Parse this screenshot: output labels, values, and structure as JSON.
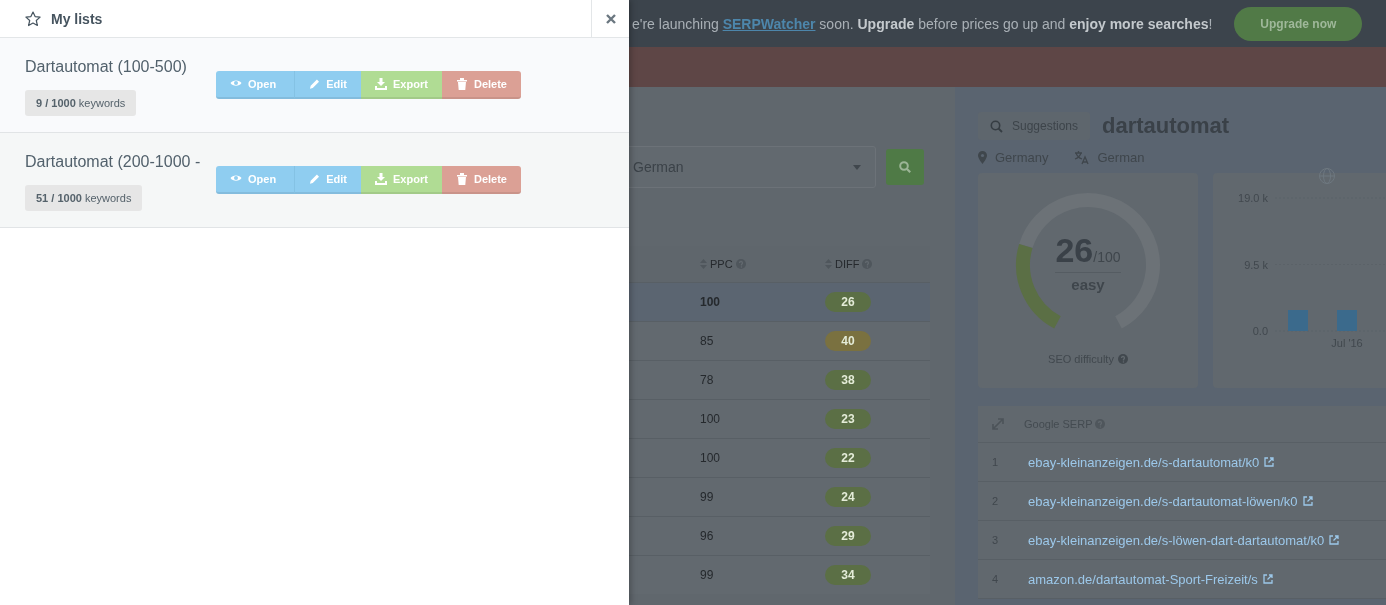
{
  "banner": {
    "segments": [
      {
        "kind": "text",
        "text": "e're launching "
      },
      {
        "kind": "link",
        "text": "SERPWatcher"
      },
      {
        "kind": "text",
        "text": " soon. **Upgrade** before prices go up and **enjoy more searches**!"
      }
    ],
    "button": "Upgrade now"
  },
  "keyword_table": {
    "language": "German",
    "columns": [
      "PPC",
      "DIFF"
    ],
    "rows": [
      {
        "ppc": "100",
        "diff": "26",
        "color": "#5b6f45",
        "selected": true
      },
      {
        "ppc": "85",
        "diff": "40",
        "color": "#7a7140",
        "selected": false
      },
      {
        "ppc": "78",
        "diff": "38",
        "color": "#5b6f45",
        "selected": false
      },
      {
        "ppc": "100",
        "diff": "23",
        "color": "#5b6f45",
        "selected": false
      },
      {
        "ppc": "100",
        "diff": "22",
        "color": "#5b6f45",
        "selected": false
      },
      {
        "ppc": "99",
        "diff": "24",
        "color": "#5b6f45",
        "selected": false
      },
      {
        "ppc": "96",
        "diff": "29",
        "color": "#5b6f45",
        "selected": false
      },
      {
        "ppc": "99",
        "diff": "34",
        "color": "#5b6f45",
        "selected": false
      }
    ]
  },
  "keyword_panel": {
    "suggestions": "Suggestions",
    "keyword": "dartautomat",
    "location": "Germany",
    "language": "German",
    "difficulty": {
      "score": "26",
      "max": "/100",
      "label": "easy",
      "caption": "SEO difficulty",
      "level": 0.26
    },
    "chart_data": {
      "type": "bar",
      "categories": [
        null,
        "Jul '16"
      ],
      "values": [
        3000,
        3000
      ],
      "yticks": [
        {
          "value": 0,
          "label": "0.0"
        },
        {
          "value": 9500,
          "label": "9.5 k"
        },
        {
          "value": 19000,
          "label": "19.0 k"
        }
      ],
      "ylim": [
        0,
        19000
      ]
    },
    "serp": {
      "heading": "Google SERP",
      "rows": [
        {
          "rank": "1",
          "url": "ebay-kleinanzeigen.de/s-dartautomat/k0"
        },
        {
          "rank": "2",
          "url": "ebay-kleinanzeigen.de/s-dartautomat-löwen/k0"
        },
        {
          "rank": "3",
          "url": "ebay-kleinanzeigen.de/s-löwen-dart-dartautomat/k0"
        },
        {
          "rank": "4",
          "url": "amazon.de/dartautomat-Sport-Freizeit/s"
        }
      ]
    }
  },
  "drawer": {
    "title": "My lists",
    "lists": [
      {
        "title": "Dartautomat (100-500)",
        "keywords": "**9 / 1000** keywords",
        "actions": [
          {
            "kind": "open",
            "label": "Open"
          },
          {
            "kind": "edit",
            "label": "Edit"
          },
          {
            "kind": "export",
            "label": "Export"
          },
          {
            "kind": "delete",
            "label": "Delete"
          }
        ]
      },
      {
        "title": "Dartautomat (200-1000 -",
        "keywords": "**51 / 1000** keywords",
        "actions": [
          {
            "kind": "open",
            "label": "Open"
          },
          {
            "kind": "edit",
            "label": "Edit"
          },
          {
            "kind": "export",
            "label": "Export"
          },
          {
            "kind": "delete",
            "label": "Delete"
          }
        ]
      }
    ]
  }
}
